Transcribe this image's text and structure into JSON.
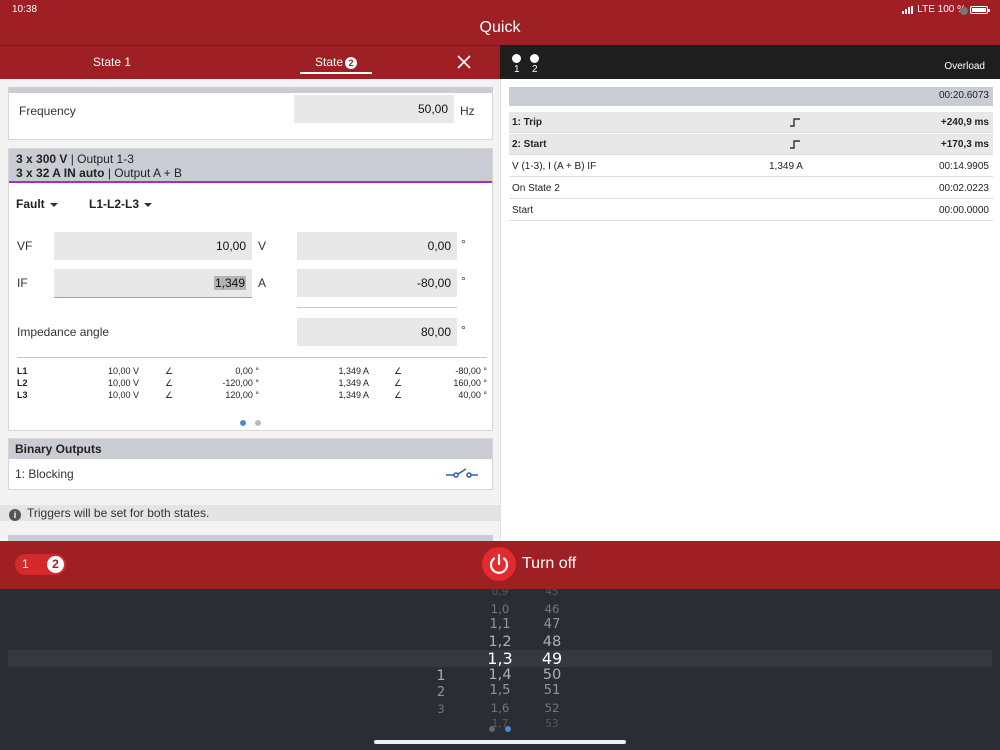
{
  "status": {
    "time": "10:38",
    "network": "LTE 100 %"
  },
  "app": {
    "title": "Quick"
  },
  "tabs": [
    {
      "label": "State 1"
    },
    {
      "label": "State",
      "badge": "2"
    }
  ],
  "right_header": {
    "items": [
      "1",
      "2"
    ],
    "overload": "Overload"
  },
  "frequency": {
    "label": "Frequency",
    "value": "50,00",
    "unit": "Hz"
  },
  "generator": {
    "line1_bold": "3 x 300 V",
    "line1_rest": "| Output 1-3",
    "line2_bold": "3 x 32 A IN auto",
    "line2_rest": "| Output A + B",
    "fault_label": "Fault",
    "phase_select": "L1-L2-L3",
    "vf": {
      "label": "VF",
      "value": "10,00",
      "unit": "V",
      "angle": "0,00",
      "angle_unit": "°"
    },
    "if": {
      "label": "IF",
      "value": "1,349",
      "unit": "A",
      "angle": "-80,00",
      "angle_unit": "°"
    },
    "impedance": {
      "label": "Impedance angle",
      "value": "80,00",
      "unit": "°"
    },
    "phases": [
      {
        "name": "L1",
        "v": "10,00 V",
        "v_ang": "0,00 °",
        "i": "1,349 A",
        "i_ang": "-80,00 °"
      },
      {
        "name": "L2",
        "v": "10,00 V",
        "v_ang": "-120,00 °",
        "i": "1,349 A",
        "i_ang": "160,00 °"
      },
      {
        "name": "L3",
        "v": "10,00 V",
        "v_ang": "120,00 °",
        "i": "1,349 A",
        "i_ang": "40,00 °"
      }
    ],
    "angle_symbol": "∠"
  },
  "binary_outputs": {
    "title": "Binary Outputs",
    "item": "1: Blocking"
  },
  "note": "Triggers will be set for both states.",
  "events": {
    "header_time": "00:20.6073",
    "rows": [
      {
        "label": "1: Trip",
        "mid": "",
        "value": "+240,9 ms"
      },
      {
        "label": "2: Start",
        "mid": "",
        "value": "+170,3 ms"
      },
      {
        "label": "V (1-3), I (A + B) IF",
        "mid": "1,349 A",
        "value": "00:14.9905"
      },
      {
        "label": "On State 2",
        "mid": "",
        "value": "00:02.0223"
      },
      {
        "label": "Start",
        "mid": "",
        "value": "00:00.0000"
      }
    ]
  },
  "control": {
    "toggle_left": "1",
    "toggle_right": "2",
    "turn_off": "Turn off"
  },
  "picker": {
    "col1": [
      "1",
      "2",
      "3"
    ],
    "col2": [
      "0,9",
      "1,0",
      "1,1",
      "1,2",
      "1,3",
      "1,4",
      "1,5",
      "1,6",
      "1,7"
    ],
    "col3": [
      "45",
      "46",
      "47",
      "48",
      "49",
      "50",
      "51",
      "52",
      "53"
    ]
  },
  "colors": {
    "brand": "#9e1f24",
    "accent_purple": "#a22bd4",
    "dark": "#1e1e1e"
  }
}
